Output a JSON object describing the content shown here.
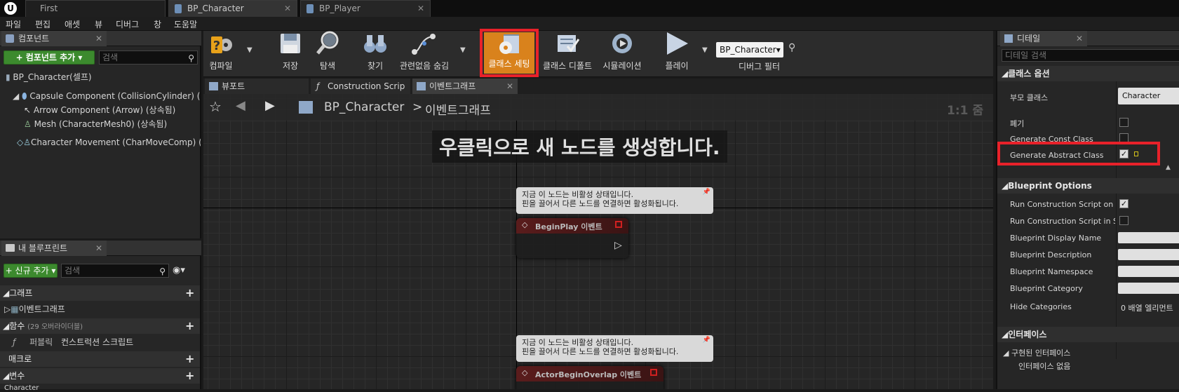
{
  "tabs": [
    {
      "label": "First"
    },
    {
      "label": "BP_Character"
    },
    {
      "label": "BP_Player"
    }
  ],
  "menu": [
    "파일",
    "편집",
    "애셋",
    "뷰",
    "디버그",
    "창",
    "도움말"
  ],
  "components_panel": {
    "tab": "컴포넌트",
    "add_button": "+ 컴포넌트 추가 ▾",
    "search_placeholder": "검색",
    "root": "BP_Character(셀프)",
    "items": [
      "Capsule Component (CollisionCylinder) (상속",
      "Arrow Component (Arrow) (상속됨)",
      "Mesh (CharacterMesh0) (상속됨)",
      "Character Movement (CharMoveComp) (상속"
    ]
  },
  "blueprint_panel": {
    "tab": "내 블루프린트",
    "new_button": "+ 신규 추가 ▾",
    "search_placeholder": "검색",
    "sections": {
      "graph": "그래프",
      "graph_item": "이벤트그래프",
      "functions": "함수",
      "functions_note": "(29 오버라이더블)",
      "function_access": "퍼블릭",
      "function_item": "컨스트럭션 스크립트",
      "macros": "매크로",
      "variables": "변수",
      "variables_sub": "Character"
    }
  },
  "toolbar": {
    "compile": "컴파일",
    "save": "저장",
    "browse": "탐색",
    "find": "찾기",
    "hide_unrelated": "관련없음 숨김",
    "class_settings": "클래스 세팅",
    "class_defaults": "클래스 디폴트",
    "simulation": "시뮬레이션",
    "play": "플레이",
    "debug_object": "BP_Character▾",
    "debug_filter": "디버그 필터"
  },
  "editor_tabs": [
    {
      "label": "뷰포트"
    },
    {
      "label": "Construction Scrip"
    },
    {
      "label": "이벤트그래프"
    }
  ],
  "graph": {
    "breadcrumb_root": "BP_Character",
    "breadcrumb_sep": ">",
    "breadcrumb_current": "이벤트그래프",
    "zoom": "1:1 줌",
    "hint": "우클릭으로 새 노드를 생성합니다.",
    "nodes": [
      {
        "bubble_line1": "지금 이 노드는 비활성 상태입니다.",
        "bubble_line2": "핀을 끌어서 다른 노드를 연결하면 활성화됩니다.",
        "title": "BeginPlay 이벤트"
      },
      {
        "bubble_line1": "지금 이 노드는 비활성 상태입니다.",
        "bubble_line2": "핀을 끌어서 다른 노드를 연결하면 활성화됩니다.",
        "title": "ActorBeginOverlap 이벤트"
      }
    ]
  },
  "details": {
    "tab": "디테일",
    "search_placeholder": "디테일 검색",
    "class_options": "클래스 옵션",
    "parent_class_label": "부모 클래스",
    "parent_class_value": "Character",
    "deprecate": "폐기",
    "generate_const": "Generate Const Class",
    "generate_abstract": "Generate Abstract Class",
    "blueprint_options": "Blueprint Options",
    "run_cs_drag": "Run Construction Script on Dra",
    "run_cs_seq": "Run Construction Script in Seq",
    "display_name": "Blueprint Display Name",
    "description": "Blueprint Description",
    "namespace": "Blueprint Namespace",
    "category": "Blueprint Category",
    "hide_categories": "Hide Categories",
    "hide_categories_value": "0 배열 엘리먼트",
    "interfaces": "인터페이스",
    "implemented": "구현된 인터페이스",
    "no_interfaces": "인터페이스 없음"
  },
  "colors": {
    "highlight": "#e8212a",
    "accent_green": "#3c8a2e",
    "class_settings_bg": "#d9821c"
  }
}
